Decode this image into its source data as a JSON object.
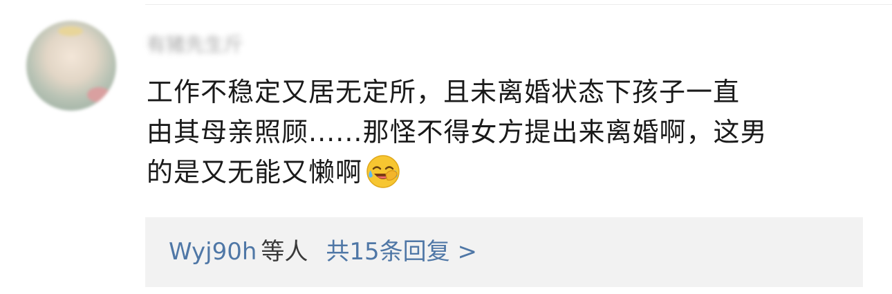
{
  "comment": {
    "author_name": "有猪先生斤",
    "lines": [
      "工作不稳定又居无定所，且未离婚状态下孩子一直",
      "由其母亲照顾......那怪不得女方提出来离婚啊，这男",
      "的是又无能又懒啊"
    ],
    "emoji": "laughing-tears-emoji"
  },
  "replies": {
    "replier": "Wyj90h",
    "suffix": "等人",
    "count_text": "共15条回复 >"
  },
  "colors": {
    "link": "#4f77a6",
    "text": "#1a1a1a",
    "reply_bg": "#f2f2f2"
  }
}
